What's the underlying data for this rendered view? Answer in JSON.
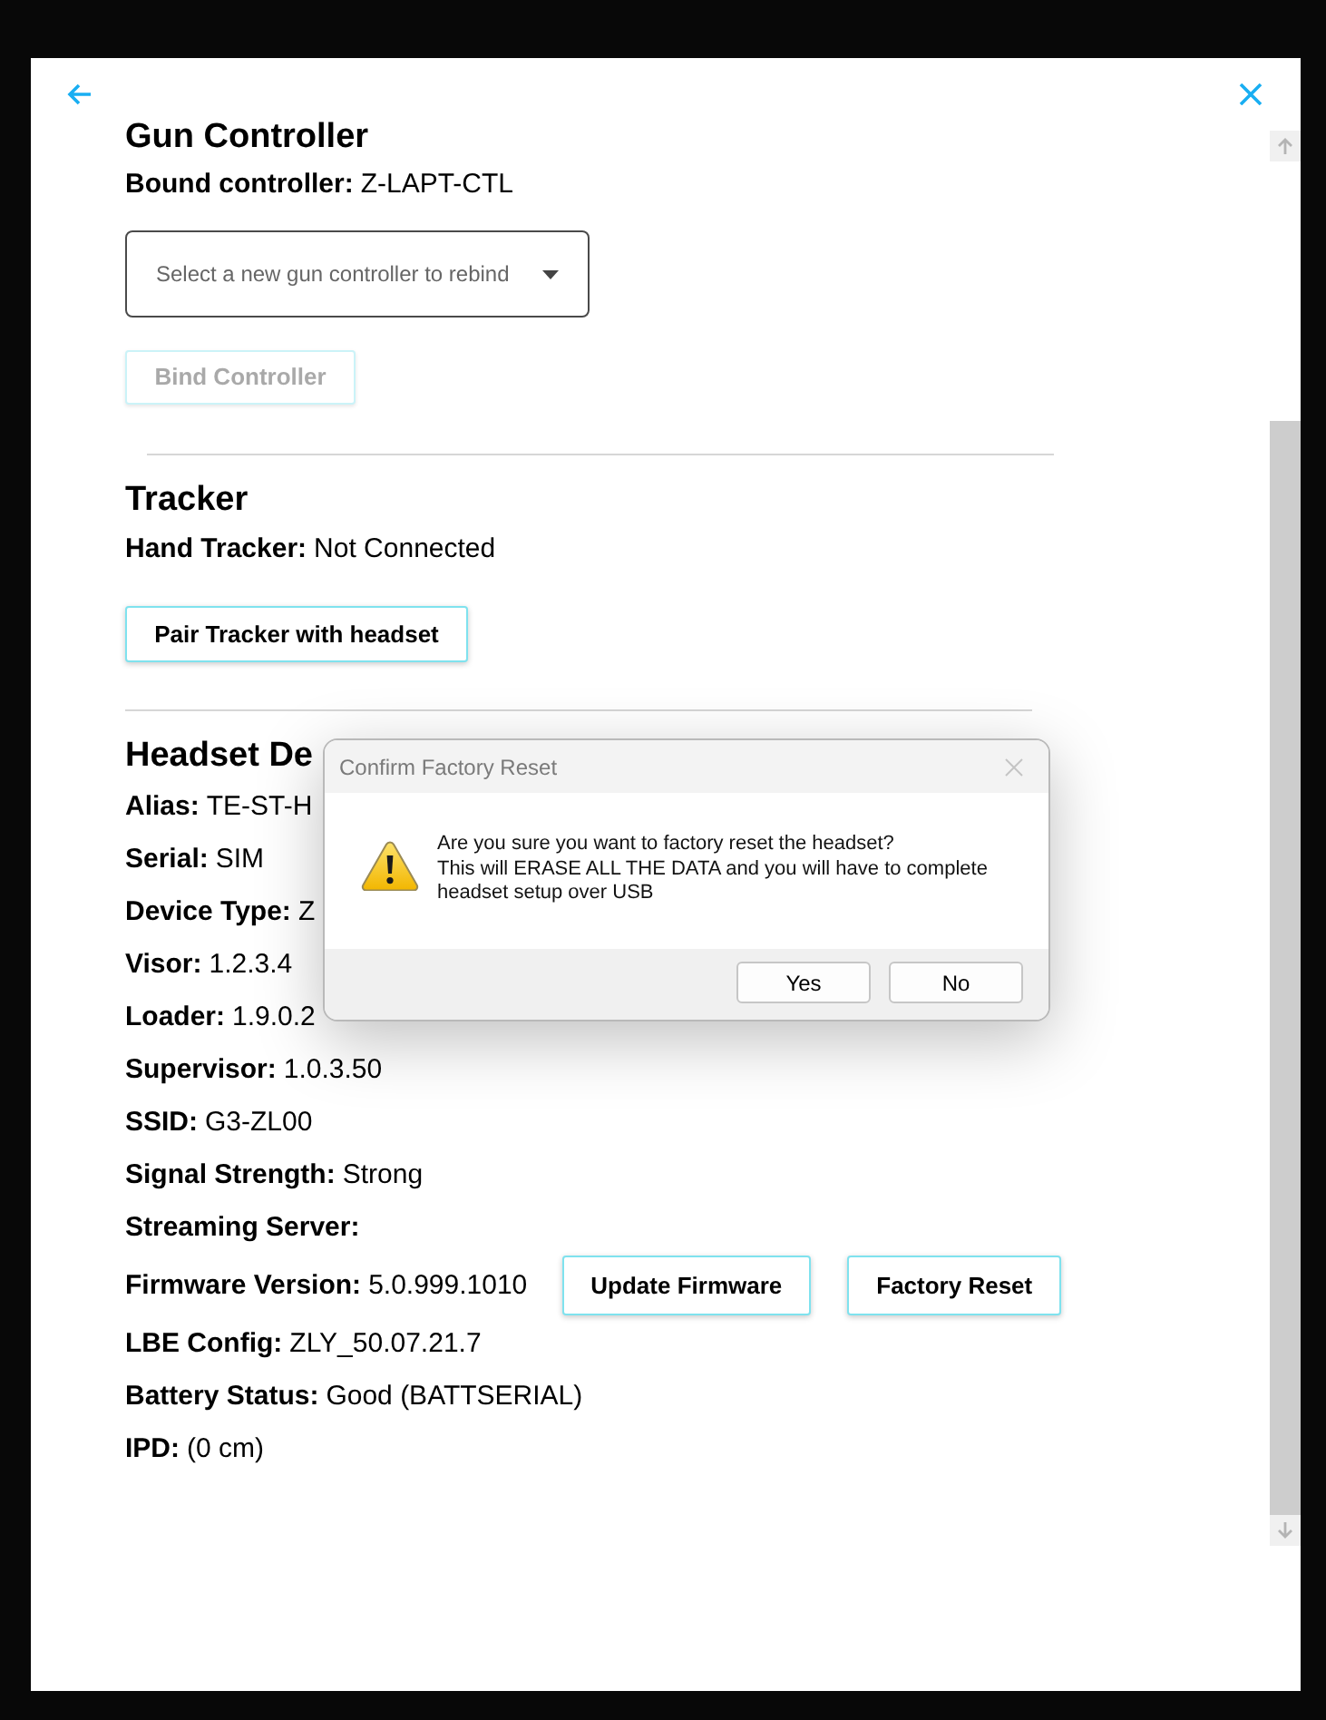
{
  "gun_controller": {
    "heading": "Gun Controller",
    "bound_controller": {
      "label": "Bound controller:",
      "value": "Z-LAPT-CTL"
    },
    "select": {
      "placeholder": "Select a new gun controller to rebind"
    },
    "bind_button": {
      "label": "Bind Controller",
      "disabled": true
    }
  },
  "tracker": {
    "heading": "Tracker",
    "fields": [
      {
        "label": "Hand Tracker:",
        "value": "Not Connected"
      }
    ],
    "pair_button": {
      "label": "Pair Tracker with headset",
      "disabled": false
    }
  },
  "headset_details": {
    "heading": "Headset De",
    "fields": [
      {
        "label": "Alias:",
        "value": "TE-ST-H"
      },
      {
        "label": "Serial:",
        "value": "SIM"
      },
      {
        "label": "Device Type:",
        "value": "Z"
      },
      {
        "label": "Visor:",
        "value": "1.2.3.4"
      },
      {
        "label": "Loader:",
        "value": "1.9.0.2"
      },
      {
        "label": "Supervisor:",
        "value": "1.0.3.50"
      },
      {
        "label": "SSID:",
        "value": "G3-ZL00"
      },
      {
        "label": "Signal Strength:",
        "value": "Strong"
      },
      {
        "label": "Streaming Server:"
      },
      {
        "label": "Firmware Version:",
        "value": "5.0.999.1010",
        "buttons": [
          "Update Firmware",
          "Factory Reset"
        ]
      },
      {
        "label": "LBE Config:",
        "value": "ZLY_50.07.21.7"
      },
      {
        "label": "Battery Status:",
        "value": "Good (BATTSERIAL)"
      },
      {
        "label": "IPD:",
        "value": "(0 cm)"
      }
    ]
  },
  "dialog": {
    "title": "Confirm Factory Reset",
    "message": "Are you sure you want to factory reset the headset?\nThis will ERASE ALL THE DATA and you will have to complete headset setup over USB",
    "buttons": [
      "Yes",
      "No"
    ]
  }
}
